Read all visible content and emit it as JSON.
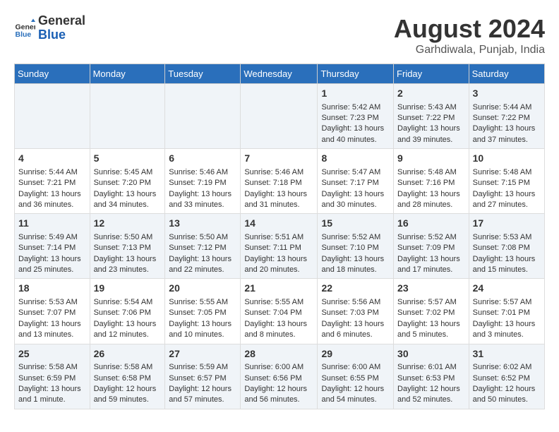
{
  "header": {
    "logo_line1": "General",
    "logo_line2": "Blue",
    "month_title": "August 2024",
    "location": "Garhdiwala, Punjab, India"
  },
  "days_of_week": [
    "Sunday",
    "Monday",
    "Tuesday",
    "Wednesday",
    "Thursday",
    "Friday",
    "Saturday"
  ],
  "weeks": [
    [
      {
        "day": "",
        "content": ""
      },
      {
        "day": "",
        "content": ""
      },
      {
        "day": "",
        "content": ""
      },
      {
        "day": "",
        "content": ""
      },
      {
        "day": "1",
        "content": "Sunrise: 5:42 AM\nSunset: 7:23 PM\nDaylight: 13 hours\nand 40 minutes."
      },
      {
        "day": "2",
        "content": "Sunrise: 5:43 AM\nSunset: 7:22 PM\nDaylight: 13 hours\nand 39 minutes."
      },
      {
        "day": "3",
        "content": "Sunrise: 5:44 AM\nSunset: 7:22 PM\nDaylight: 13 hours\nand 37 minutes."
      }
    ],
    [
      {
        "day": "4",
        "content": "Sunrise: 5:44 AM\nSunset: 7:21 PM\nDaylight: 13 hours\nand 36 minutes."
      },
      {
        "day": "5",
        "content": "Sunrise: 5:45 AM\nSunset: 7:20 PM\nDaylight: 13 hours\nand 34 minutes."
      },
      {
        "day": "6",
        "content": "Sunrise: 5:46 AM\nSunset: 7:19 PM\nDaylight: 13 hours\nand 33 minutes."
      },
      {
        "day": "7",
        "content": "Sunrise: 5:46 AM\nSunset: 7:18 PM\nDaylight: 13 hours\nand 31 minutes."
      },
      {
        "day": "8",
        "content": "Sunrise: 5:47 AM\nSunset: 7:17 PM\nDaylight: 13 hours\nand 30 minutes."
      },
      {
        "day": "9",
        "content": "Sunrise: 5:48 AM\nSunset: 7:16 PM\nDaylight: 13 hours\nand 28 minutes."
      },
      {
        "day": "10",
        "content": "Sunrise: 5:48 AM\nSunset: 7:15 PM\nDaylight: 13 hours\nand 27 minutes."
      }
    ],
    [
      {
        "day": "11",
        "content": "Sunrise: 5:49 AM\nSunset: 7:14 PM\nDaylight: 13 hours\nand 25 minutes."
      },
      {
        "day": "12",
        "content": "Sunrise: 5:50 AM\nSunset: 7:13 PM\nDaylight: 13 hours\nand 23 minutes."
      },
      {
        "day": "13",
        "content": "Sunrise: 5:50 AM\nSunset: 7:12 PM\nDaylight: 13 hours\nand 22 minutes."
      },
      {
        "day": "14",
        "content": "Sunrise: 5:51 AM\nSunset: 7:11 PM\nDaylight: 13 hours\nand 20 minutes."
      },
      {
        "day": "15",
        "content": "Sunrise: 5:52 AM\nSunset: 7:10 PM\nDaylight: 13 hours\nand 18 minutes."
      },
      {
        "day": "16",
        "content": "Sunrise: 5:52 AM\nSunset: 7:09 PM\nDaylight: 13 hours\nand 17 minutes."
      },
      {
        "day": "17",
        "content": "Sunrise: 5:53 AM\nSunset: 7:08 PM\nDaylight: 13 hours\nand 15 minutes."
      }
    ],
    [
      {
        "day": "18",
        "content": "Sunrise: 5:53 AM\nSunset: 7:07 PM\nDaylight: 13 hours\nand 13 minutes."
      },
      {
        "day": "19",
        "content": "Sunrise: 5:54 AM\nSunset: 7:06 PM\nDaylight: 13 hours\nand 12 minutes."
      },
      {
        "day": "20",
        "content": "Sunrise: 5:55 AM\nSunset: 7:05 PM\nDaylight: 13 hours\nand 10 minutes."
      },
      {
        "day": "21",
        "content": "Sunrise: 5:55 AM\nSunset: 7:04 PM\nDaylight: 13 hours\nand 8 minutes."
      },
      {
        "day": "22",
        "content": "Sunrise: 5:56 AM\nSunset: 7:03 PM\nDaylight: 13 hours\nand 6 minutes."
      },
      {
        "day": "23",
        "content": "Sunrise: 5:57 AM\nSunset: 7:02 PM\nDaylight: 13 hours\nand 5 minutes."
      },
      {
        "day": "24",
        "content": "Sunrise: 5:57 AM\nSunset: 7:01 PM\nDaylight: 13 hours\nand 3 minutes."
      }
    ],
    [
      {
        "day": "25",
        "content": "Sunrise: 5:58 AM\nSunset: 6:59 PM\nDaylight: 13 hours\nand 1 minute."
      },
      {
        "day": "26",
        "content": "Sunrise: 5:58 AM\nSunset: 6:58 PM\nDaylight: 12 hours\nand 59 minutes."
      },
      {
        "day": "27",
        "content": "Sunrise: 5:59 AM\nSunset: 6:57 PM\nDaylight: 12 hours\nand 57 minutes."
      },
      {
        "day": "28",
        "content": "Sunrise: 6:00 AM\nSunset: 6:56 PM\nDaylight: 12 hours\nand 56 minutes."
      },
      {
        "day": "29",
        "content": "Sunrise: 6:00 AM\nSunset: 6:55 PM\nDaylight: 12 hours\nand 54 minutes."
      },
      {
        "day": "30",
        "content": "Sunrise: 6:01 AM\nSunset: 6:53 PM\nDaylight: 12 hours\nand 52 minutes."
      },
      {
        "day": "31",
        "content": "Sunrise: 6:02 AM\nSunset: 6:52 PM\nDaylight: 12 hours\nand 50 minutes."
      }
    ]
  ]
}
